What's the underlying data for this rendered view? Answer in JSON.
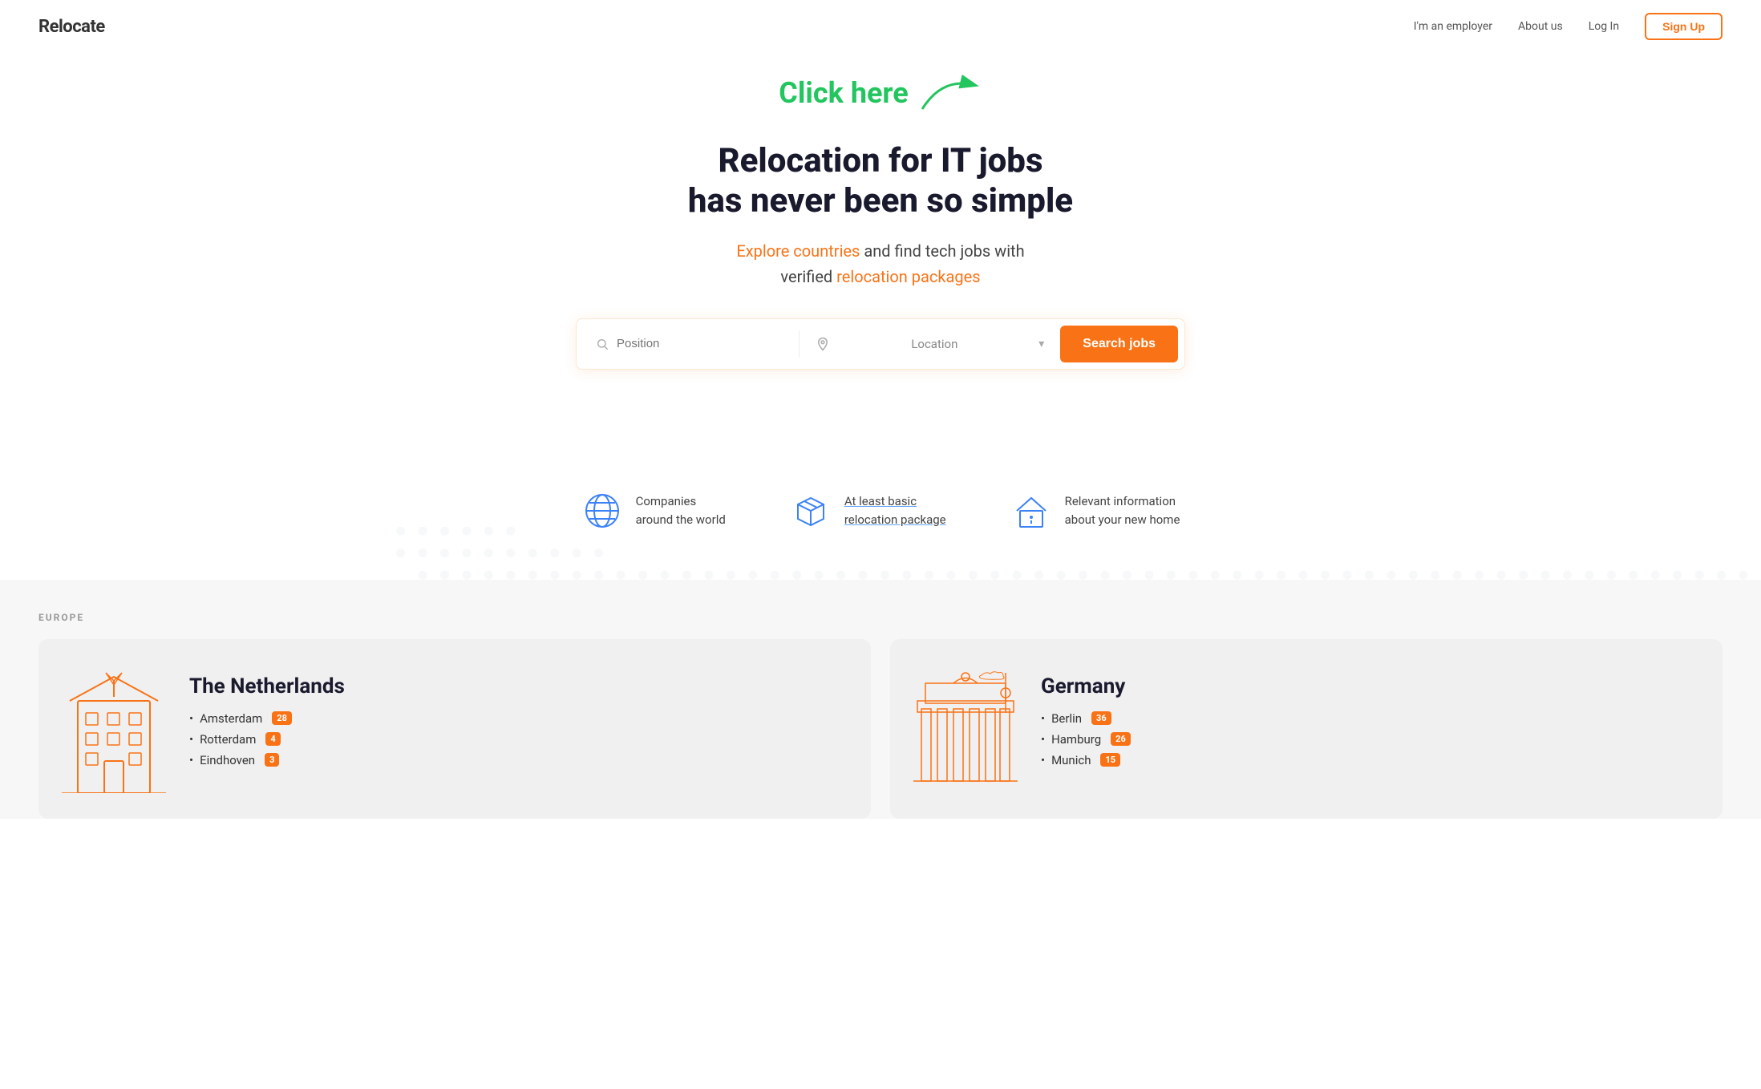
{
  "navbar": {
    "logo": "Relocate",
    "links": [
      {
        "label": "I'm an employer",
        "id": "employer-link"
      },
      {
        "label": "About us",
        "id": "about-link"
      },
      {
        "label": "Log In",
        "id": "login-link"
      }
    ],
    "signup_label": "Sign Up"
  },
  "annotation": {
    "click_here": "Click here"
  },
  "hero": {
    "title_line1": "Relocation for IT jobs",
    "title_line2": "has never been so simple",
    "subtitle_before": "Explore countries",
    "subtitle_middle": " and find tech jobs with",
    "subtitle_line2_before": "verified ",
    "subtitle_highlighted": "relocation packages"
  },
  "search": {
    "position_placeholder": "Position",
    "location_placeholder": "Location",
    "button_label": "Search jobs"
  },
  "features": [
    {
      "id": "global",
      "icon_name": "globe-icon",
      "text_line1": "Companies",
      "text_line2": "around the world"
    },
    {
      "id": "package",
      "icon_name": "box-icon",
      "text_line1": "At least basic",
      "text_line2": "relocation package",
      "underline": true
    },
    {
      "id": "info",
      "icon_name": "home-info-icon",
      "text_line1": "Relevant information",
      "text_line2": "about your new home"
    }
  ],
  "europe_section": {
    "label": "EUROPE",
    "countries": [
      {
        "name": "The Netherlands",
        "cities": [
          {
            "name": "Amsterdam",
            "count": 28
          },
          {
            "name": "Rotterdam",
            "count": 4
          },
          {
            "name": "Eindhoven",
            "count": 3
          }
        ]
      },
      {
        "name": "Germany",
        "cities": [
          {
            "name": "Berlin",
            "count": 36
          },
          {
            "name": "Hamburg",
            "count": 26
          },
          {
            "name": "Munich",
            "count": 15
          }
        ]
      }
    ]
  }
}
